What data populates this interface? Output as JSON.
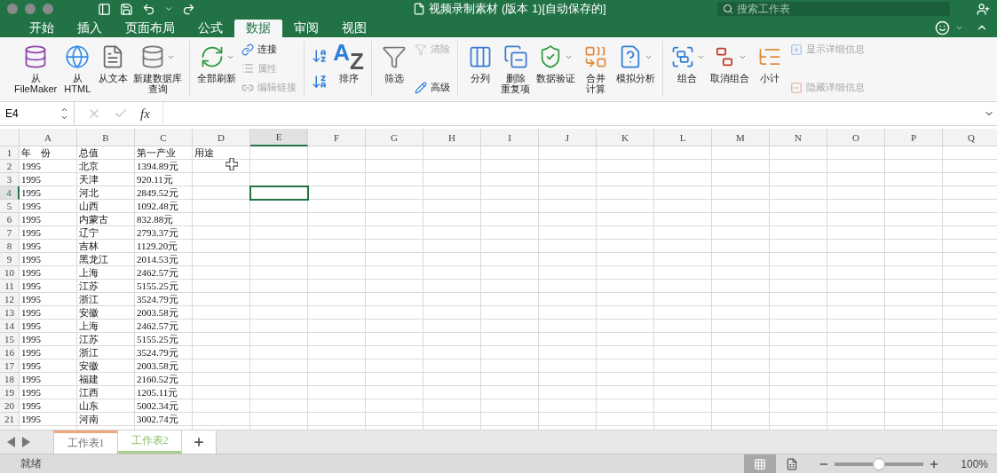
{
  "window": {
    "title": "视频录制素材 (版本 1)[自动保存的]",
    "search": {
      "placeholder": "搜索工作表"
    }
  },
  "tabs": [
    {
      "label": "开始",
      "selected": false
    },
    {
      "label": "插入",
      "selected": false
    },
    {
      "label": "页面布局",
      "selected": false
    },
    {
      "label": "公式",
      "selected": false
    },
    {
      "label": "数据",
      "selected": true
    },
    {
      "label": "审阅",
      "selected": false
    },
    {
      "label": "视图",
      "selected": false
    }
  ],
  "ribbon": {
    "groups": [
      {
        "items": [
          {
            "kind": "large",
            "lines": [
              "从",
              "FileMaker"
            ],
            "dropdown": false
          },
          {
            "kind": "large",
            "lines": [
              "从",
              "HTML"
            ],
            "dropdown": false
          },
          {
            "kind": "large",
            "lines": [
              "从文本"
            ],
            "dropdown": false
          },
          {
            "kind": "large",
            "lines": [
              "新建数据库",
              "查询"
            ],
            "dropdown": true
          }
        ]
      },
      {
        "items": [
          {
            "kind": "large",
            "lines": [
              "全部刷新"
            ],
            "dropdown": true
          },
          {
            "kind": "stack",
            "buttons": [
              {
                "label": "连接",
                "disabled": false
              },
              {
                "label": "属性",
                "disabled": true
              },
              {
                "label": "编辑链接",
                "disabled": true
              }
            ]
          }
        ]
      },
      {
        "items": [
          {
            "kind": "sortstack"
          },
          {
            "kind": "sort",
            "glyph": [
              "A",
              "Z"
            ],
            "lines": [
              "排序"
            ]
          }
        ]
      },
      {
        "items": [
          {
            "kind": "large",
            "lines": [
              "筛选"
            ],
            "dropdown": false
          },
          {
            "kind": "stack",
            "buttons": [
              {
                "label": "清除",
                "disabled": true
              },
              {
                "label": "高级",
                "disabled": false
              }
            ]
          }
        ]
      },
      {
        "items": [
          {
            "kind": "large",
            "lines": [
              "分列"
            ],
            "dropdown": false
          },
          {
            "kind": "large",
            "lines": [
              "删除",
              "重复项"
            ],
            "dropdown": false
          },
          {
            "kind": "large",
            "lines": [
              "数据验证"
            ],
            "dropdown": true
          },
          {
            "kind": "large",
            "lines": [
              "合并",
              "计算"
            ],
            "dropdown": false
          },
          {
            "kind": "large",
            "lines": [
              "模拟分析"
            ],
            "dropdown": true
          }
        ]
      },
      {
        "items": [
          {
            "kind": "large",
            "lines": [
              "组合"
            ],
            "dropdown": true
          },
          {
            "kind": "large",
            "lines": [
              "取消组合"
            ],
            "dropdown": true
          },
          {
            "kind": "large",
            "lines": [
              "小计"
            ],
            "dropdown": false
          },
          {
            "kind": "stack",
            "buttons": [
              {
                "label": "显示详细信息",
                "disabled": true
              },
              {
                "label": "隐藏详细信息",
                "disabled": true
              }
            ]
          }
        ]
      }
    ]
  },
  "formula_bar": {
    "name_box": "E4",
    "fx": "fx"
  },
  "sheet": {
    "columns": [
      {
        "label": "A",
        "selected": false
      },
      {
        "label": "B",
        "selected": false
      },
      {
        "label": "C",
        "selected": false
      },
      {
        "label": "D",
        "selected": false
      },
      {
        "label": "E",
        "selected": true
      },
      {
        "label": "F",
        "selected": false
      },
      {
        "label": "G",
        "selected": false
      },
      {
        "label": "H",
        "selected": false
      },
      {
        "label": "I",
        "selected": false
      },
      {
        "label": "J",
        "selected": false
      },
      {
        "label": "K",
        "selected": false
      },
      {
        "label": "L",
        "selected": false
      },
      {
        "label": "M",
        "selected": false
      },
      {
        "label": "N",
        "selected": false
      },
      {
        "label": "O",
        "selected": false
      },
      {
        "label": "P",
        "selected": false
      },
      {
        "label": "Q",
        "selected": false
      }
    ],
    "rows": [
      {
        "number": "1",
        "selected": false,
        "cells": [
          "年　份",
          "总值",
          "第一产业",
          "用途"
        ]
      },
      {
        "number": "2",
        "selected": false,
        "cells": [
          "1995",
          "北京",
          "1394.89元"
        ]
      },
      {
        "number": "3",
        "selected": false,
        "cells": [
          "1995",
          "天津",
          "920.11元"
        ]
      },
      {
        "number": "4",
        "selected": true,
        "cells": [
          "1995",
          "河北",
          "2849.52元"
        ]
      },
      {
        "number": "5",
        "selected": false,
        "cells": [
          "1995",
          "山西",
          "1092.48元"
        ]
      },
      {
        "number": "6",
        "selected": false,
        "cells": [
          "1995",
          "内蒙古",
          "832.88元"
        ]
      },
      {
        "number": "7",
        "selected": false,
        "cells": [
          "1995",
          "辽宁",
          "2793.37元"
        ]
      },
      {
        "number": "8",
        "selected": false,
        "cells": [
          "1995",
          "吉林",
          "1129.20元"
        ]
      },
      {
        "number": "9",
        "selected": false,
        "cells": [
          "1995",
          "黑龙江",
          "2014.53元"
        ]
      },
      {
        "number": "10",
        "selected": false,
        "cells": [
          "1995",
          "上海",
          "2462.57元"
        ]
      },
      {
        "number": "11",
        "selected": false,
        "cells": [
          "1995",
          "江苏",
          "5155.25元"
        ]
      },
      {
        "number": "12",
        "selected": false,
        "cells": [
          "1995",
          "浙江",
          "3524.79元"
        ]
      },
      {
        "number": "13",
        "selected": false,
        "cells": [
          "1995",
          "安徽",
          "2003.58元"
        ]
      },
      {
        "number": "14",
        "selected": false,
        "cells": [
          "1995",
          "上海",
          "2462.57元"
        ]
      },
      {
        "number": "15",
        "selected": false,
        "cells": [
          "1995",
          "江苏",
          "5155.25元"
        ]
      },
      {
        "number": "16",
        "selected": false,
        "cells": [
          "1995",
          "浙江",
          "3524.79元"
        ]
      },
      {
        "number": "17",
        "selected": false,
        "cells": [
          "1995",
          "安徽",
          "2003.58元"
        ]
      },
      {
        "number": "18",
        "selected": false,
        "cells": [
          "1995",
          "福建",
          "2160.52元"
        ]
      },
      {
        "number": "19",
        "selected": false,
        "cells": [
          "1995",
          "江西",
          "1205.11元"
        ]
      },
      {
        "number": "20",
        "selected": false,
        "cells": [
          "1995",
          "山东",
          "5002.34元"
        ]
      },
      {
        "number": "21",
        "selected": false,
        "cells": [
          "1995",
          "河南",
          "3002.74元"
        ]
      }
    ]
  },
  "sheet_tabs": [
    {
      "label": "工作表1",
      "selected": false,
      "color": "#f0a878"
    },
    {
      "label": "工作表2",
      "selected": true,
      "color": "#a8d08d"
    }
  ],
  "status_bar": {
    "text": "就绪",
    "views": [
      {
        "kind": "normal",
        "selected": true
      },
      {
        "kind": "page",
        "selected": false
      }
    ],
    "zoom": {
      "level": 0.5,
      "label": "100%"
    }
  }
}
